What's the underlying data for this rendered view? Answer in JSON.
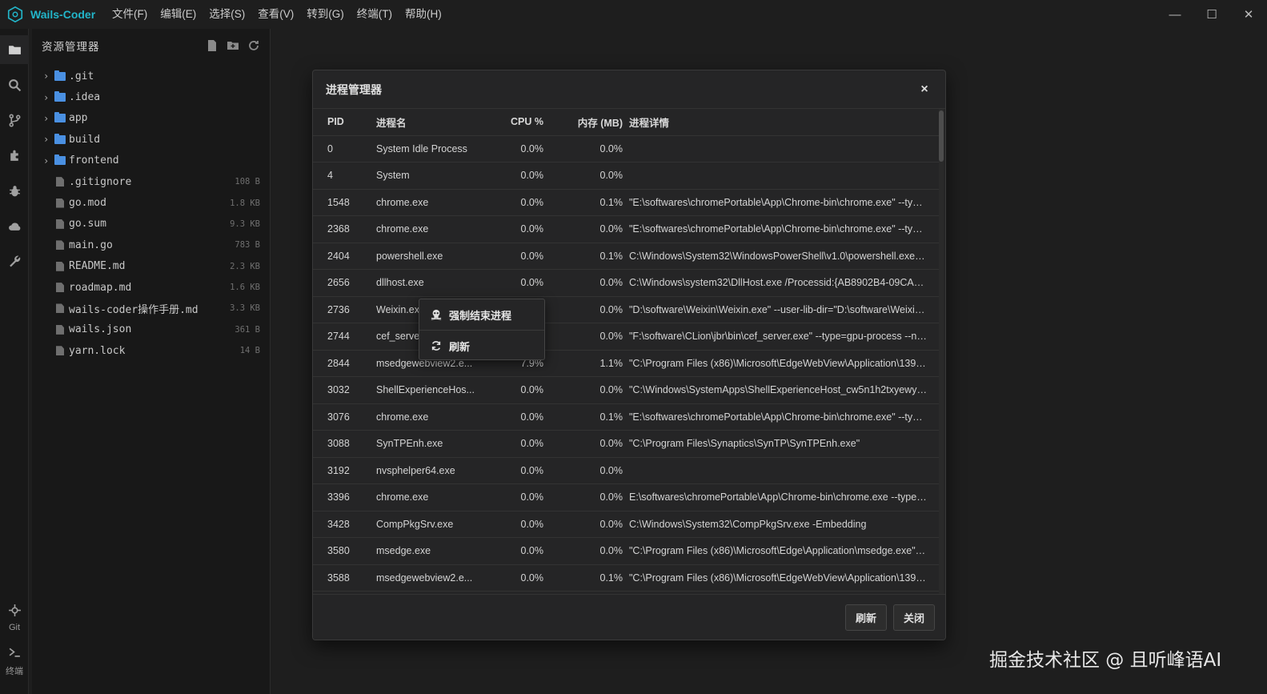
{
  "app": {
    "title": "Wails-Coder"
  },
  "menu": [
    "文件(F)",
    "编辑(E)",
    "选择(S)",
    "查看(V)",
    "转到(G)",
    "终端(T)",
    "帮助(H)"
  ],
  "window_controls": {
    "minimize": "—",
    "maximize": "☐",
    "close": "✕"
  },
  "activity_bar": {
    "items": [
      "explorer-icon",
      "search-icon",
      "source-control-icon",
      "extensions-icon",
      "debug-icon",
      "cloud-icon",
      "tools-icon"
    ],
    "git_label": "Git",
    "terminal_label": "终端"
  },
  "explorer": {
    "title": "资源管理器",
    "folders": [
      ".git",
      ".idea",
      "app",
      "build",
      "frontend"
    ],
    "files": [
      {
        "name": ".gitignore",
        "size": "108 B"
      },
      {
        "name": "go.mod",
        "size": "1.8 KB"
      },
      {
        "name": "go.sum",
        "size": "9.3 KB"
      },
      {
        "name": "main.go",
        "size": "783 B"
      },
      {
        "name": "README.md",
        "size": "2.3 KB"
      },
      {
        "name": "roadmap.md",
        "size": "1.6 KB"
      },
      {
        "name": "wails-coder操作手册.md",
        "size": "3.3 KB"
      },
      {
        "name": "wails.json",
        "size": "361 B"
      },
      {
        "name": "yarn.lock",
        "size": "14 B"
      }
    ]
  },
  "process_manager": {
    "title": "进程管理器",
    "close": "×",
    "columns": [
      "PID",
      "进程名",
      "CPU %",
      "内存 (MB)",
      "进程详情"
    ],
    "rows": [
      [
        "0",
        "System Idle Process",
        "0.0%",
        "0.0%",
        ""
      ],
      [
        "4",
        "System",
        "0.0%",
        "0.0%",
        ""
      ],
      [
        "1548",
        "chrome.exe",
        "0.0%",
        "0.1%",
        "\"E:\\softwares\\chromePortable\\App\\Chrome-bin\\chrome.exe\" --type..."
      ],
      [
        "2368",
        "chrome.exe",
        "0.0%",
        "0.0%",
        "\"E:\\softwares\\chromePortable\\App\\Chrome-bin\\chrome.exe\" --type..."
      ],
      [
        "2404",
        "powershell.exe",
        "0.0%",
        "0.1%",
        "C:\\Windows\\System32\\WindowsPowerShell\\v1.0\\powershell.exe -no..."
      ],
      [
        "2656",
        "dllhost.exe",
        "0.0%",
        "0.0%",
        "C:\\Windows\\system32\\DllHost.exe /Processid:{AB8902B4-09CA-4BB..."
      ],
      [
        "2736",
        "Weixin.exe",
        "",
        "0.0%",
        "\"D:\\software\\Weixin\\Weixin.exe\" --user-lib-dir=\"D:\\software\\Weixin\\..."
      ],
      [
        "2744",
        "cef_server.exe",
        "",
        "0.0%",
        "\"F:\\software\\CLion\\jbr\\bin\\cef_server.exe\" --type=gpu-process --no-..."
      ],
      [
        "2844",
        "msedgewebview2.e...",
        "7.9%",
        "1.1%",
        "\"C:\\Program Files (x86)\\Microsoft\\EdgeWebView\\Application\\139.0.3..."
      ],
      [
        "3032",
        "ShellExperienceHos...",
        "0.0%",
        "0.0%",
        "\"C:\\Windows\\SystemApps\\ShellExperienceHost_cw5n1h2txyewy\\She..."
      ],
      [
        "3076",
        "chrome.exe",
        "0.0%",
        "0.1%",
        "\"E:\\softwares\\chromePortable\\App\\Chrome-bin\\chrome.exe\" --type..."
      ],
      [
        "3088",
        "SynTPEnh.exe",
        "0.0%",
        "0.0%",
        "\"C:\\Program Files\\Synaptics\\SynTP\\SynTPEnh.exe\""
      ],
      [
        "3192",
        "nvsphelper64.exe",
        "0.0%",
        "0.0%",
        ""
      ],
      [
        "3396",
        "chrome.exe",
        "0.0%",
        "0.0%",
        "E:\\softwares\\chromePortable\\App\\Chrome-bin\\chrome.exe --type=c..."
      ],
      [
        "3428",
        "CompPkgSrv.exe",
        "0.0%",
        "0.0%",
        "C:\\Windows\\System32\\CompPkgSrv.exe -Embedding"
      ],
      [
        "3580",
        "msedge.exe",
        "0.0%",
        "0.0%",
        "\"C:\\Program Files (x86)\\Microsoft\\Edge\\Application\\msedge.exe\" --t..."
      ],
      [
        "3588",
        "msedgewebview2.e...",
        "0.0%",
        "0.1%",
        "\"C:\\Program Files (x86)\\Microsoft\\EdgeWebView\\Application\\139.0.3..."
      ]
    ],
    "buttons": {
      "refresh": "刷新",
      "close": "关闭"
    }
  },
  "context_menu": {
    "items": [
      {
        "label": "强制结束进程",
        "icon": "skull-icon"
      },
      {
        "label": "刷新",
        "icon": "refresh-icon"
      }
    ]
  },
  "watermark": "掘金技术社区 @ 且听峰语AI",
  "colors": {
    "accent": "#22b5c9",
    "folder": "#4a90e2",
    "background": "#1e1e1e",
    "panel": "#252526"
  }
}
